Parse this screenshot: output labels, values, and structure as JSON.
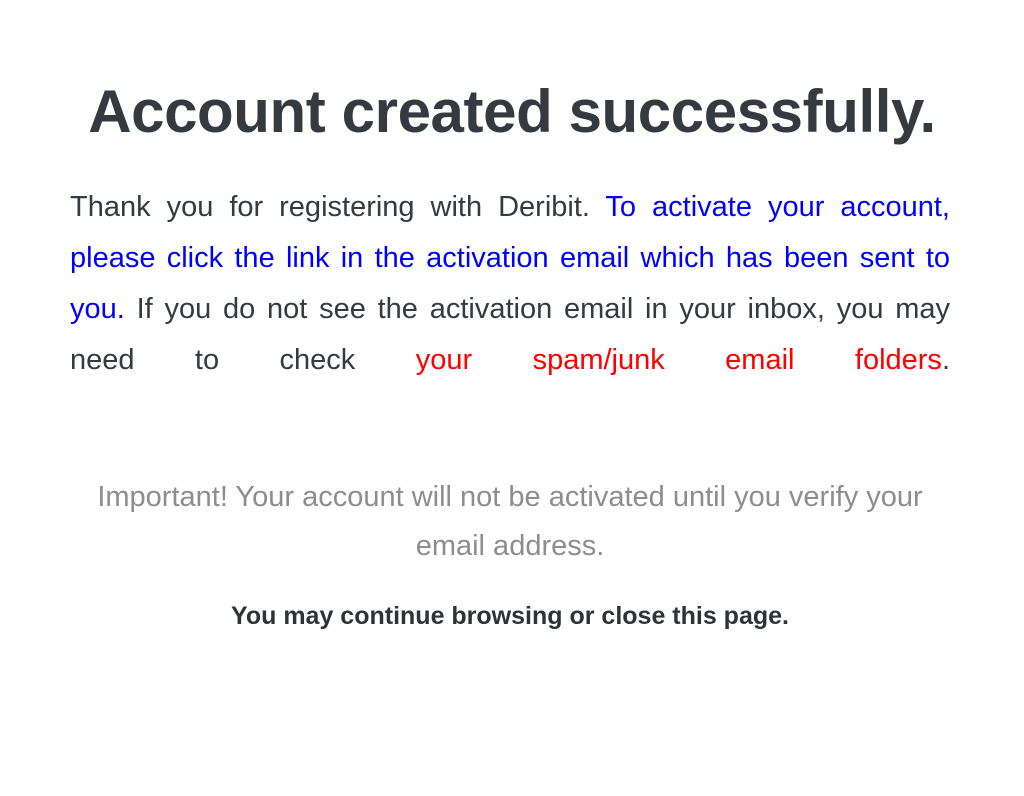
{
  "page": {
    "background_color": "#ffffff",
    "heading_color": "#343a40",
    "body_color": "#343a40",
    "link_color": "#0000ff",
    "warning_color": "#ff0000",
    "muted_color": "#8d8d8d"
  },
  "heading": {
    "line1": "Account created",
    "line2": "successfully.",
    "full": "Account created successfully."
  },
  "body": {
    "intro": "Thank you for registering with Deribit. ",
    "link_text": "To activate your account, please click the link in the activation email which has been sent to you.",
    "middle": " If you do not see the activation email in your inbox, you may need to check ",
    "warning_text": "your spam/junk email folders",
    "outro": "."
  },
  "important": {
    "text": "Important! Your account will not be activated until you verify your email address."
  },
  "closing": {
    "text": "You may continue browsing or close this page."
  }
}
